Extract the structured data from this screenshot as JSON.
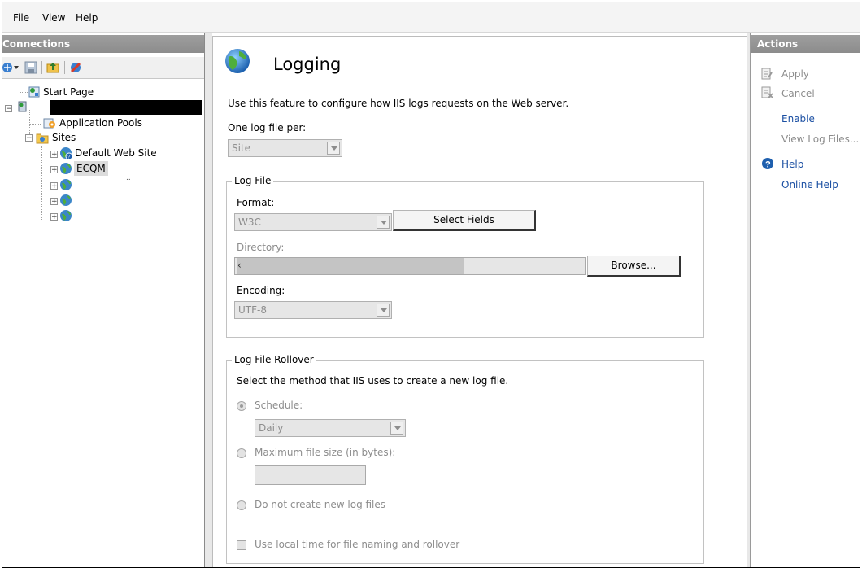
{
  "menubar": {
    "items": [
      "File",
      "View",
      "Help"
    ]
  },
  "connections": {
    "header": "Connections",
    "tree": {
      "start_page": "Start Page",
      "server_name": "",
      "app_pools": "Application Pools",
      "sites": "Sites",
      "default_site": "Default Web Site",
      "ecqm": "ECQM",
      "ecqm_sub": ".."
    }
  },
  "main": {
    "title": "Logging",
    "description": "Use this feature to configure how IIS logs requests on the Web server.",
    "one_log_label": "One log file per:",
    "one_log_value": "Site",
    "log_file": {
      "title": "Log File",
      "format_label": "Format:",
      "format_value": "W3C",
      "select_fields": "Select Fields",
      "directory_label": "Directory:",
      "directory_value": "‹",
      "browse": "Browse...",
      "encoding_label": "Encoding:",
      "encoding_value": "UTF-8"
    },
    "rollover": {
      "title": "Log File Rollover",
      "description": "Select the method that IIS uses to create a new log file.",
      "schedule_label": "Schedule:",
      "schedule_value": "Daily",
      "max_size_label": "Maximum file size (in bytes):",
      "no_new_label": "Do not create new log files",
      "local_time_label": "Use local time for file naming and rollover"
    }
  },
  "actions": {
    "header": "Actions",
    "apply": "Apply",
    "cancel": "Cancel",
    "enable": "Enable",
    "view_log_files": "View Log Files...",
    "help": "Help",
    "online_help": "Online Help"
  },
  "colors": {
    "link": "#1c50a3",
    "disabled": "#8d8d8d",
    "header": "#8c8c8c"
  }
}
